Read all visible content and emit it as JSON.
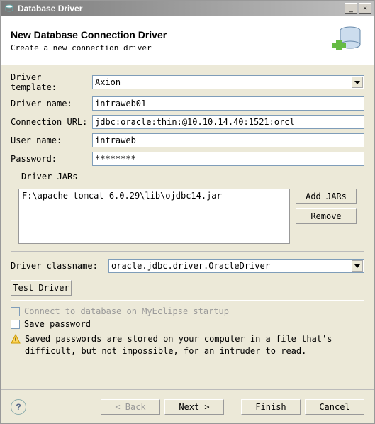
{
  "window": {
    "title": "Database Driver",
    "minimize": "_",
    "close": "×"
  },
  "header": {
    "title": "New Database Connection Driver",
    "subtitle": "Create a new connection driver"
  },
  "form": {
    "template_label": "Driver template:",
    "template_value": "Axion",
    "name_label": "Driver name:",
    "name_value": "intraweb01",
    "url_label": "Connection URL:",
    "url_value": "jdbc:oracle:thin:@10.10.14.40:1521:orcl",
    "user_label": "User name:",
    "user_value": "intraweb",
    "password_label": "Password:",
    "password_value": "********"
  },
  "jars": {
    "legend": "Driver JARs",
    "items": [
      "F:\\apache-tomcat-6.0.29\\lib\\ojdbc14.jar"
    ],
    "add_label": "Add JARs",
    "remove_label": "Remove"
  },
  "classname": {
    "label": "Driver classname:",
    "value": "oracle.jdbc.driver.OracleDriver"
  },
  "test_label": "Test Driver",
  "checks": {
    "connect_startup": "Connect to database on MyEclipse startup",
    "save_password": "Save password",
    "warning": "Saved passwords are stored on your computer in a file that's difficult, but not impossible, for an intruder to read."
  },
  "footer": {
    "help": "?",
    "back": "< Back",
    "next": "Next >",
    "finish": "Finish",
    "cancel": "Cancel"
  }
}
